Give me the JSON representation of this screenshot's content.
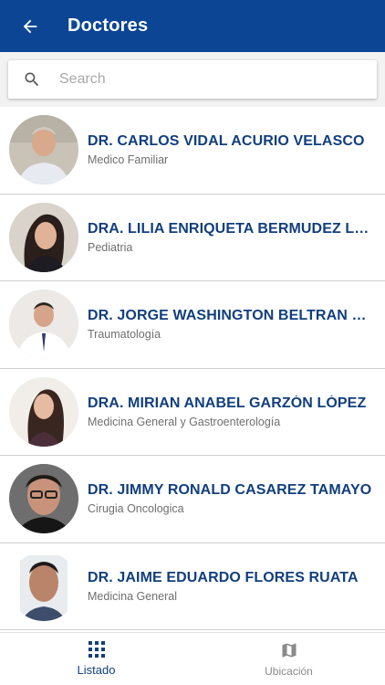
{
  "header": {
    "title": "Doctores",
    "back_icon": "arrow-left-icon"
  },
  "search": {
    "placeholder": "Search",
    "value": "",
    "icon": "search-icon"
  },
  "doctors": [
    {
      "name": "DR. CARLOS VIDAL ACURIO VELASCO",
      "specialty": "Medico Familiar"
    },
    {
      "name": "DRA. LILIA ENRIQUETA BERMUDEZ LA...",
      "specialty": "Pediatria"
    },
    {
      "name": "DR. JORGE WASHINGTON BELTRAN FR...",
      "specialty": "Traumatología"
    },
    {
      "name": "DRA. MIRIAN ANABEL GARZÓN LÓPEZ",
      "specialty": "Medicina General y Gastroenterología"
    },
    {
      "name": "DR. JIMMY RONALD CASAREZ TAMAYO",
      "specialty": "Cirugia Oncologica"
    },
    {
      "name": "DR. JAIME EDUARDO FLORES RUATA",
      "specialty": "Medicina General"
    }
  ],
  "bottom_nav": [
    {
      "label": "Listado",
      "icon": "grid-icon",
      "active": true
    },
    {
      "label": "Ubicación",
      "icon": "map-icon",
      "active": false
    }
  ],
  "colors": {
    "primary": "#0b4594",
    "name_text": "#123f7e",
    "secondary_text": "#6f6f6f"
  }
}
